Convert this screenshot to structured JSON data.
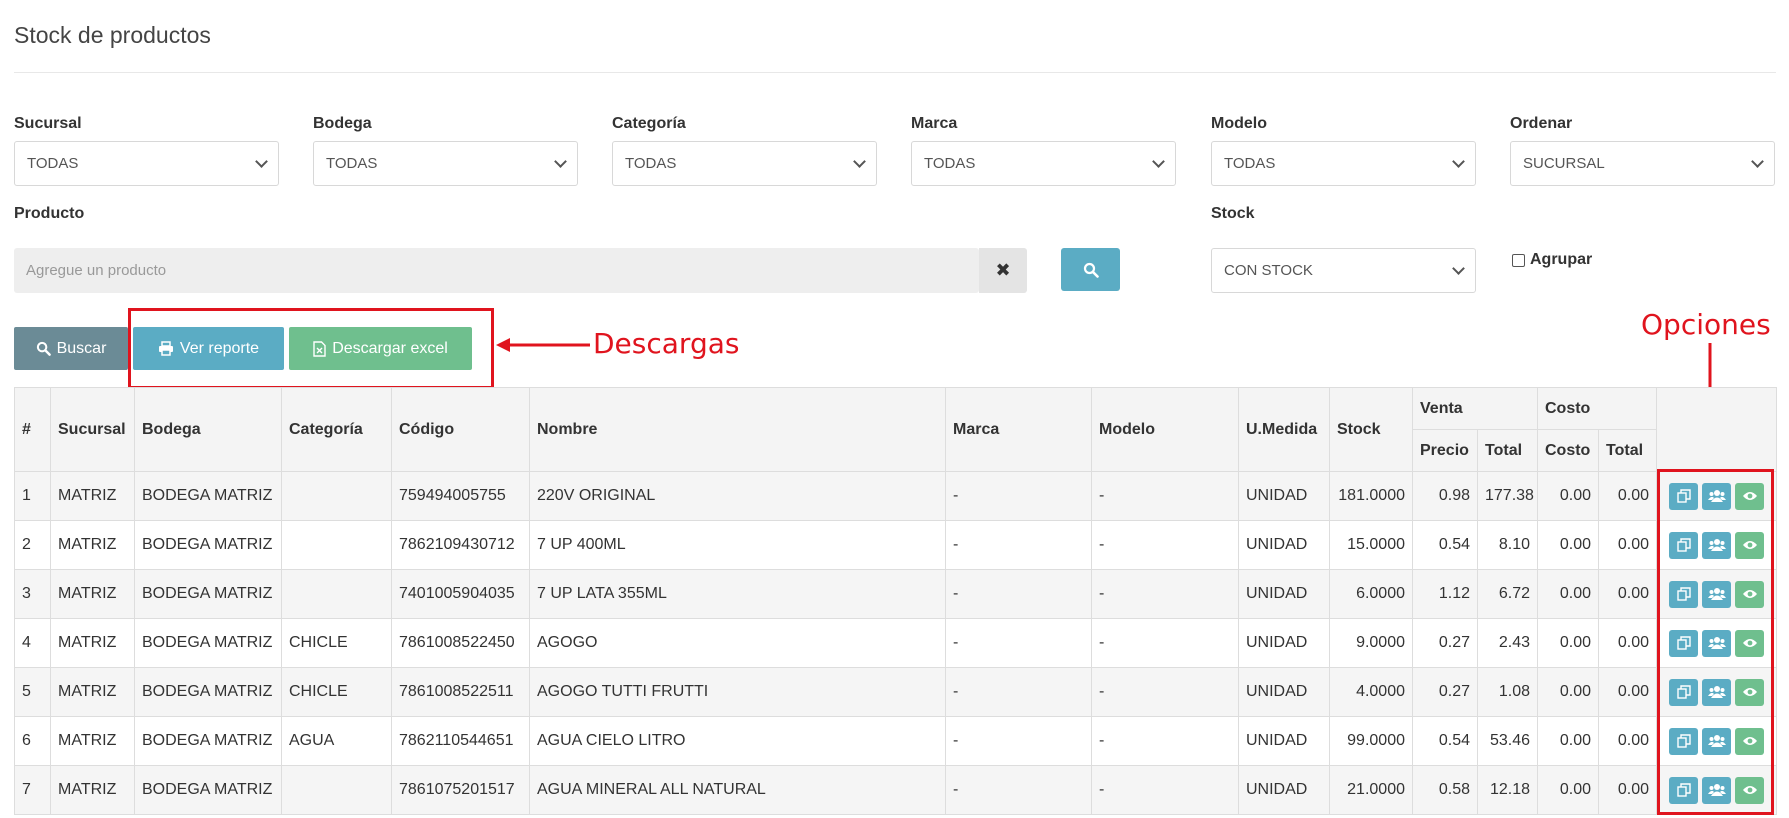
{
  "page_title": "Stock de productos",
  "filters": [
    {
      "label": "Sucursal",
      "value": "TODAS"
    },
    {
      "label": "Bodega",
      "value": "TODAS"
    },
    {
      "label": "Categoría",
      "value": "TODAS"
    },
    {
      "label": "Marca",
      "value": "TODAS"
    },
    {
      "label": "Modelo",
      "value": "TODAS"
    },
    {
      "label": "Ordenar",
      "value": "SUCURSAL"
    }
  ],
  "product": {
    "label": "Producto",
    "placeholder": "Agregue un producto"
  },
  "stock": {
    "label": "Stock",
    "value": "CON STOCK"
  },
  "agrupar_label": "Agrupar",
  "buttons": {
    "buscar": "Buscar",
    "ver_reporte": "Ver reporte",
    "descargar_excel": "Descargar excel"
  },
  "annotations": {
    "descargas": "Descargas",
    "opciones": "Opciones"
  },
  "colors": {
    "annotation": "#e0141e",
    "info": "#5bacc4",
    "success": "#6fbf8e",
    "secondary": "#6b8b96"
  },
  "table": {
    "headers": {
      "num": "#",
      "sucursal": "Sucursal",
      "bodega": "Bodega",
      "categoria": "Categoría",
      "codigo": "Código",
      "nombre": "Nombre",
      "marca": "Marca",
      "modelo": "Modelo",
      "umedida": "U.Medida",
      "stock": "Stock",
      "venta": "Venta",
      "costo_group": "Costo",
      "precio": "Precio",
      "total_venta": "Total",
      "costo": "Costo",
      "total_costo": "Total"
    },
    "rows": [
      [
        "1",
        "MATRIZ",
        "BODEGA MATRIZ",
        "",
        "759494005755",
        "220V ORIGINAL",
        "-",
        "-",
        "UNIDAD",
        "181.0000",
        "0.98",
        "177.38",
        "0.00",
        "0.00"
      ],
      [
        "2",
        "MATRIZ",
        "BODEGA MATRIZ",
        "",
        "7862109430712",
        "7 UP 400ML",
        "-",
        "-",
        "UNIDAD",
        "15.0000",
        "0.54",
        "8.10",
        "0.00",
        "0.00"
      ],
      [
        "3",
        "MATRIZ",
        "BODEGA MATRIZ",
        "",
        "7401005904035",
        "7 UP LATA 355ML",
        "-",
        "-",
        "UNIDAD",
        "6.0000",
        "1.12",
        "6.72",
        "0.00",
        "0.00"
      ],
      [
        "4",
        "MATRIZ",
        "BODEGA MATRIZ",
        "CHICLE",
        "7861008522450",
        "AGOGO",
        "-",
        "-",
        "UNIDAD",
        "9.0000",
        "0.27",
        "2.43",
        "0.00",
        "0.00"
      ],
      [
        "5",
        "MATRIZ",
        "BODEGA MATRIZ",
        "CHICLE",
        "7861008522511",
        "AGOGO TUTTI FRUTTI",
        "-",
        "-",
        "UNIDAD",
        "4.0000",
        "0.27",
        "1.08",
        "0.00",
        "0.00"
      ],
      [
        "6",
        "MATRIZ",
        "BODEGA MATRIZ",
        "AGUA",
        "7862110544651",
        "AGUA CIELO LITRO",
        "-",
        "-",
        "UNIDAD",
        "99.0000",
        "0.54",
        "53.46",
        "0.00",
        "0.00"
      ],
      [
        "7",
        "MATRIZ",
        "BODEGA MATRIZ",
        "",
        "7861075201517",
        "AGUA MINERAL ALL NATURAL",
        "-",
        "-",
        "UNIDAD",
        "21.0000",
        "0.58",
        "12.18",
        "0.00",
        "0.00"
      ]
    ],
    "row_icons": [
      "copy-icon",
      "users-icon",
      "eye-icon"
    ]
  }
}
